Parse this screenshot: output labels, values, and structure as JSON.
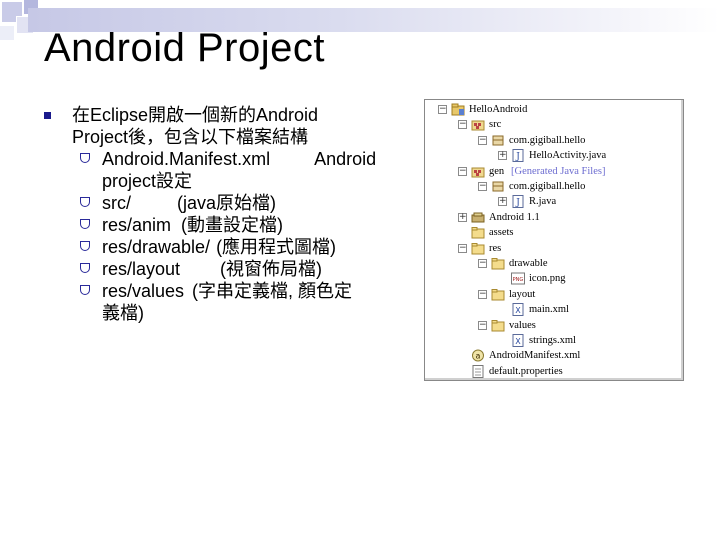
{
  "slide": {
    "title": "Android Project",
    "intro_line1": "在Eclipse開啟一個新的Android",
    "intro_line2": "Project後，包含以下檔案結構",
    "items": [
      {
        "name": "Android.Manifest.xml",
        "desc_line1": "Android",
        "desc_line2": "project設定"
      },
      {
        "name": "src/",
        "desc_line1": "(java原始檔)"
      },
      {
        "name": "res/anim",
        "desc_line1": "(動畫設定檔)"
      },
      {
        "name": "res/drawable/",
        "desc_line1": "(應用程式圖檔)"
      },
      {
        "name": "res/layout",
        "desc_line1": "(視窗佈局檔)"
      },
      {
        "name": "res/values",
        "desc_line1": "(字串定義檔, 顏色定",
        "desc_line2": "義檔)"
      }
    ]
  },
  "tree": {
    "nodes": [
      {
        "label": "HelloAndroid",
        "icon": "project-icon",
        "toggle": "-"
      },
      {
        "label": "src",
        "icon": "source-folder-icon",
        "toggle": "-"
      },
      {
        "label": "com.gigiball.hello",
        "icon": "package-icon",
        "toggle": "-"
      },
      {
        "label": "HelloActivity.java",
        "icon": "java-file-icon",
        "toggle": "+"
      },
      {
        "label": "gen",
        "note": "[Generated Java Files]",
        "icon": "source-folder-icon",
        "toggle": "-"
      },
      {
        "label": "com.gigiball.hello",
        "icon": "package-icon",
        "toggle": "-"
      },
      {
        "label": "R.java",
        "icon": "java-file-icon",
        "toggle": "+"
      },
      {
        "label": "Android 1.1",
        "icon": "library-icon",
        "toggle": "+"
      },
      {
        "label": "assets",
        "icon": "folder-icon",
        "toggle": ""
      },
      {
        "label": "res",
        "icon": "folder-icon",
        "toggle": "-"
      },
      {
        "label": "drawable",
        "icon": "folder-icon",
        "toggle": "-"
      },
      {
        "label": "icon.png",
        "icon": "png-file-icon",
        "toggle": ""
      },
      {
        "label": "layout",
        "icon": "folder-icon",
        "toggle": "-"
      },
      {
        "label": "main.xml",
        "icon": "xml-file-icon",
        "toggle": ""
      },
      {
        "label": "values",
        "icon": "folder-icon",
        "toggle": "-"
      },
      {
        "label": "strings.xml",
        "icon": "xml-file-icon",
        "toggle": ""
      },
      {
        "label": "AndroidManifest.xml",
        "icon": "manifest-icon",
        "toggle": ""
      },
      {
        "label": "default.properties",
        "icon": "properties-file-icon",
        "toggle": ""
      }
    ]
  },
  "colors": {
    "bullet": "#1a1a8c",
    "gen_note": "#6b6bd0",
    "band": "#c6c8e6"
  }
}
